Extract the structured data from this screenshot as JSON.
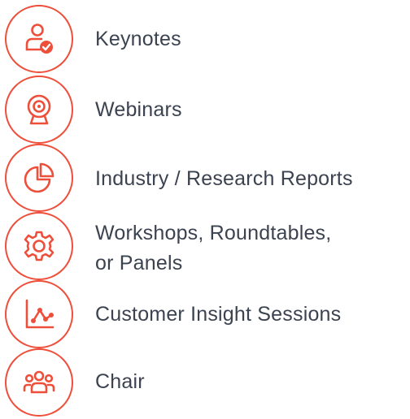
{
  "colors": {
    "accent": "#ee4f3b",
    "text": "#3b4350"
  },
  "items": [
    {
      "label": "Keynotes",
      "icon": "person-check-icon"
    },
    {
      "label": "Webinars",
      "icon": "webcam-icon"
    },
    {
      "label": "Industry / Research Reports",
      "icon": "pie-chart-icon"
    },
    {
      "label_line1": "Workshops, Roundtables,",
      "label_line2": "or Panels",
      "icon": "gear-icon"
    },
    {
      "label": "Customer Insight Sessions",
      "icon": "line-chart-icon"
    },
    {
      "label": "Chair",
      "icon": "group-icon"
    }
  ]
}
